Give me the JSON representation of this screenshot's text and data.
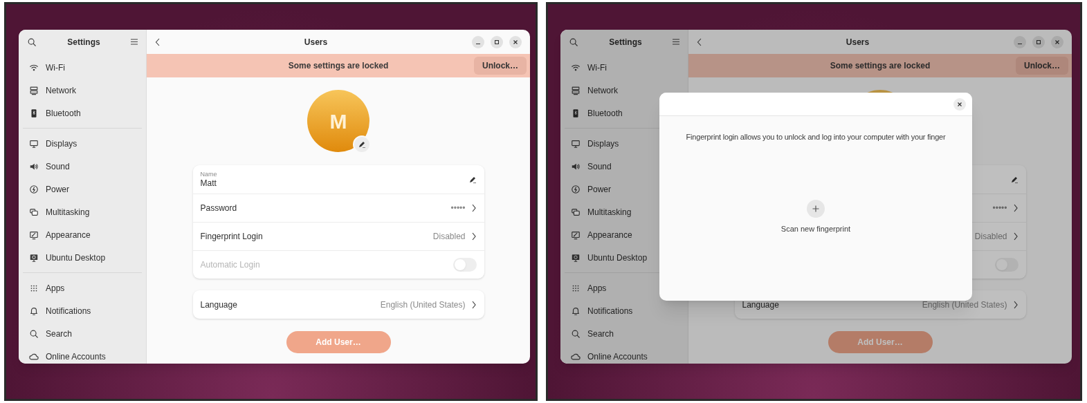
{
  "screens": [
    {
      "sidebar": {
        "title": "Settings",
        "groups": [
          [
            {
              "label": "Wi-Fi"
            },
            {
              "label": "Network"
            },
            {
              "label": "Bluetooth"
            }
          ],
          [
            {
              "label": "Displays"
            },
            {
              "label": "Sound"
            },
            {
              "label": "Power"
            },
            {
              "label": "Multitasking"
            },
            {
              "label": "Appearance"
            },
            {
              "label": "Ubuntu Desktop"
            }
          ],
          [
            {
              "label": "Apps"
            },
            {
              "label": "Notifications"
            },
            {
              "label": "Search"
            },
            {
              "label": "Online Accounts"
            }
          ]
        ]
      },
      "page": {
        "title": "Users",
        "banner": {
          "text": "Some settings are locked",
          "button": "Unlock…"
        },
        "avatar_initial": "M",
        "cards": [
          [
            {
              "kind": "name",
              "caption": "Name",
              "value": "Matt"
            },
            {
              "kind": "link",
              "label": "Password",
              "value": "•••••"
            },
            {
              "kind": "link",
              "label": "Fingerprint Login",
              "value": "Disabled"
            },
            {
              "kind": "toggle",
              "label": "Automatic Login",
              "on": false,
              "disabled": true
            }
          ],
          [
            {
              "kind": "link",
              "label": "Language",
              "value": "English (United States)"
            }
          ]
        ],
        "add_button": "Add User…"
      }
    },
    {
      "sidebar": {
        "title": "Settings",
        "groups": [
          [
            {
              "label": "Wi-Fi"
            },
            {
              "label": "Network"
            },
            {
              "label": "Bluetooth"
            }
          ],
          [
            {
              "label": "Displays"
            },
            {
              "label": "Sound"
            },
            {
              "label": "Power"
            },
            {
              "label": "Multitasking"
            },
            {
              "label": "Appearance"
            },
            {
              "label": "Ubuntu Desktop"
            }
          ],
          [
            {
              "label": "Apps"
            },
            {
              "label": "Notifications"
            },
            {
              "label": "Search"
            },
            {
              "label": "Online Accounts"
            }
          ]
        ]
      },
      "page": {
        "title": "Users",
        "banner": {
          "text": "Some settings are locked",
          "button": "Unlock…"
        },
        "cards": [
          [
            {
              "kind": "name"
            },
            {
              "kind": "link",
              "value": "•••••"
            },
            {
              "kind": "link",
              "value": "Disabled"
            },
            {
              "kind": "toggle",
              "on": false,
              "disabled": true
            }
          ],
          [
            {
              "kind": "link",
              "label": "Language",
              "value": "English (United States)"
            }
          ]
        ],
        "add_button": "Add User…"
      },
      "dialog": {
        "text": "Fingerprint login allows you to unlock and log into your computer with your finger",
        "action": "Scan new fingerprint"
      }
    }
  ]
}
